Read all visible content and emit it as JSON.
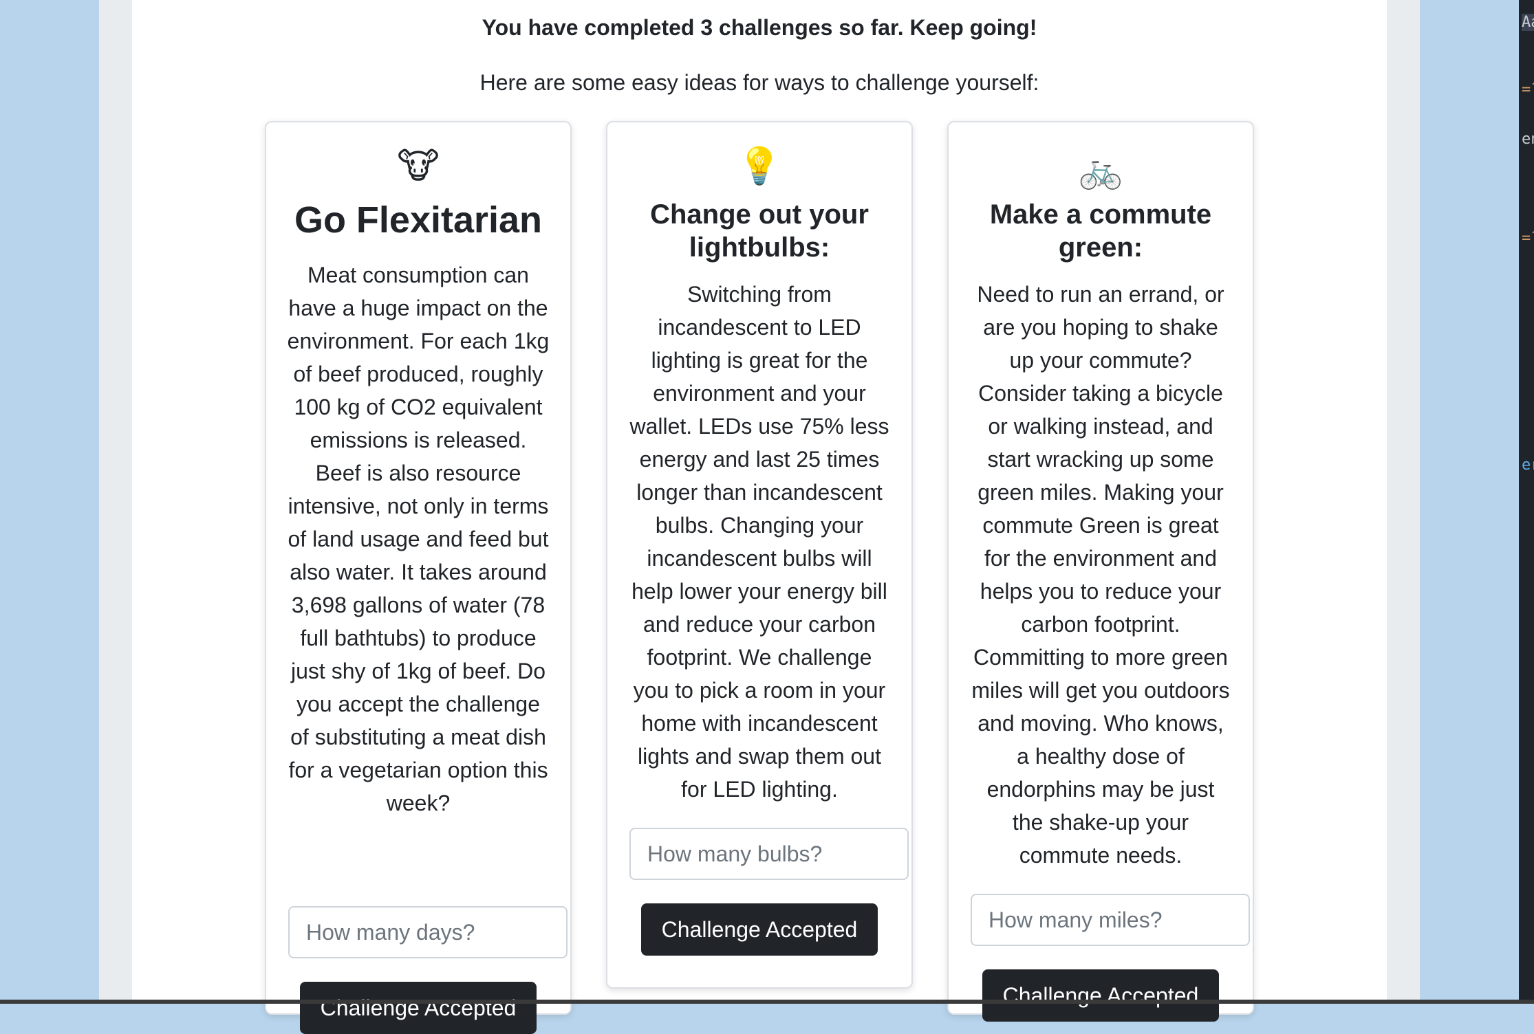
{
  "summary": {
    "headline": "You have completed 3 challenges so far. Keep going!",
    "intro": "Here are some easy ideas for ways to challenge yourself:"
  },
  "cards": [
    {
      "icon": "🐮",
      "icon_name": "cow-face-icon",
      "title": "Go Flexitarian",
      "body": "Meat consumption can have a huge impact on the environment. For each 1kg of beef produced, roughly 100 kg of CO2 equivalent emissions is released. Beef is also resource intensive, not only in terms of land usage and feed but also water. It takes around 3,698 gallons of water (78 full bathtubs) to produce just shy of 1kg of beef. Do you accept the challenge of substituting a meat dish for a vegetarian option this week?",
      "input_placeholder": "How many days?",
      "input_value": "",
      "button_label": "Challenge Accepted"
    },
    {
      "icon": "💡",
      "icon_name": "lightbulb-icon",
      "title": "Change out your lightbulbs:",
      "body": "Switching from incandescent to LED lighting is great for the environment and your wallet. LEDs use 75% less energy and last 25 times longer than incandescent bulbs. Changing your incandescent bulbs will help lower your energy bill and reduce your carbon footprint. We challenge you to pick a room in your home with incandescent lights and swap them out for LED lighting.",
      "input_placeholder": "How many bulbs?",
      "input_value": "",
      "button_label": "Challenge Accepted"
    },
    {
      "icon": "🚲",
      "icon_name": "bicycle-icon",
      "title": "Make a commute green:",
      "body": "Need to run an errand, or are you hoping to shake up your commute? Consider taking a bicycle or walking instead, and start wracking up some green miles. Making your commute Green is great for the environment and helps you to reduce your carbon footprint. Committing to more green miles will get you outdoors and moving. Who knows, a healthy dose of endorphins may be just the shake-up your commute needs.",
      "input_placeholder": "How many miles?",
      "input_value": "",
      "button_label": "Challenge Accepted"
    }
  ],
  "editor_peek": {
    "fragments": [
      "Aa",
      "=?",
      "en",
      "=?",
      "er"
    ],
    "colors": {
      "background": "#1f232a",
      "default": "#c8ccd4",
      "orange": "#d19a66",
      "blue": "#61afef"
    }
  },
  "colors": {
    "desktop": "#b8d4ec",
    "window": "#e9ecef",
    "page": "#ffffff",
    "button": "#212529",
    "button_text": "#ffffff",
    "border": "#dcdfe3"
  }
}
